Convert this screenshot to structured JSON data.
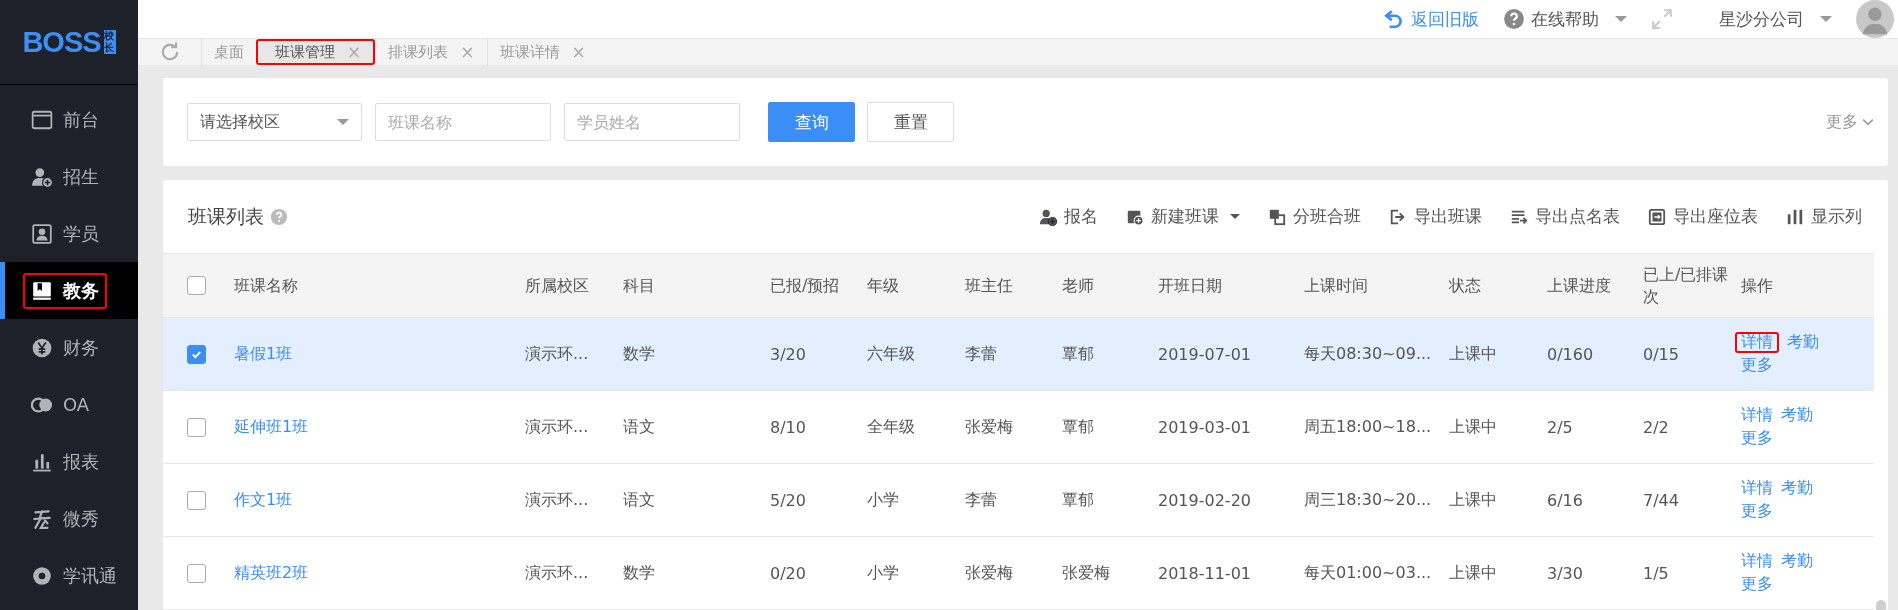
{
  "logo": {
    "text": "BOSS",
    "badge": "校长"
  },
  "sidebar": {
    "items": [
      {
        "label": "前台",
        "selected": false,
        "annotated": false
      },
      {
        "label": "招生",
        "selected": false,
        "annotated": false
      },
      {
        "label": "学员",
        "selected": false,
        "annotated": false
      },
      {
        "label": "教务",
        "selected": true,
        "annotated": true
      },
      {
        "label": "财务",
        "selected": false,
        "annotated": false
      },
      {
        "label": "OA",
        "selected": false,
        "annotated": false
      },
      {
        "label": "报表",
        "selected": false,
        "annotated": false
      },
      {
        "label": "微秀",
        "selected": false,
        "annotated": false
      },
      {
        "label": "学讯通",
        "selected": false,
        "annotated": false
      }
    ]
  },
  "header": {
    "back_link": "返回旧版",
    "help": "在线帮助",
    "company": "星沙分公司"
  },
  "tabs": [
    {
      "label": "桌面",
      "closable": false,
      "selected": false,
      "annotated": false
    },
    {
      "label": "班课管理",
      "closable": true,
      "selected": true,
      "annotated": true
    },
    {
      "label": "排课列表",
      "closable": true,
      "selected": false,
      "annotated": false
    },
    {
      "label": "班课详情",
      "closable": true,
      "selected": false,
      "annotated": false
    }
  ],
  "tab_close": "×",
  "filters": {
    "campus_select": {
      "placeholder": "请选择校区"
    },
    "class_name": {
      "placeholder": "班课名称"
    },
    "student_name": {
      "placeholder": "学员姓名"
    },
    "search_button": "查询",
    "reset_button": "重置",
    "more": "更多"
  },
  "table_card": {
    "title": "班课列表",
    "toolbar": [
      {
        "label": "报名",
        "dropdown": false
      },
      {
        "label": "新建班课",
        "dropdown": true
      },
      {
        "label": "分班合班",
        "dropdown": false
      },
      {
        "label": "导出班课",
        "dropdown": false
      },
      {
        "label": "导出点名表",
        "dropdown": false
      },
      {
        "label": "导出座位表",
        "dropdown": false
      },
      {
        "label": "显示列",
        "dropdown": false
      }
    ],
    "columns": [
      "班课名称",
      "所属校区",
      "科目",
      "已报/预招",
      "年级",
      "班主任",
      "老师",
      "开班日期",
      "上课时间",
      "状态",
      "上课进度",
      "已上/已排课次",
      "操作"
    ],
    "header_checked": false,
    "rows": [
      {
        "checked": true,
        "cells": [
          "暑假1班",
          "演示环...",
          "数学",
          "3/20",
          "六年级",
          "李蕾",
          "覃郁",
          "2019-07-01",
          "每天08:30~09...",
          "上课中",
          "0/160",
          "0/15"
        ],
        "actions": [
          {
            "label": "详情",
            "annotated": true
          },
          {
            "label": "考勤",
            "annotated": false
          },
          {
            "label": "更多",
            "annotated": false
          }
        ]
      },
      {
        "checked": false,
        "cells": [
          "延伸班1班",
          "演示环...",
          "语文",
          "8/10",
          "全年级",
          "张爱梅",
          "覃郁",
          "2019-03-01",
          "周五18:00~18...",
          "上课中",
          "2/5",
          "2/2"
        ],
        "actions": [
          {
            "label": "详情",
            "annotated": false
          },
          {
            "label": "考勤",
            "annotated": false
          },
          {
            "label": "更多",
            "annotated": false
          }
        ]
      },
      {
        "checked": false,
        "cells": [
          "作文1班",
          "演示环...",
          "语文",
          "5/20",
          "小学",
          "李蕾",
          "覃郁",
          "2019-02-20",
          "周三18:30~20...",
          "上课中",
          "6/16",
          "7/44"
        ],
        "actions": [
          {
            "label": "详情",
            "annotated": false
          },
          {
            "label": "考勤",
            "annotated": false
          },
          {
            "label": "更多",
            "annotated": false
          }
        ]
      },
      {
        "checked": false,
        "cells": [
          "精英班2班",
          "演示环...",
          "数学",
          "0/20",
          "小学",
          "张爱梅",
          "张爱梅",
          "2018-11-01",
          "每天01:00~03...",
          "上课中",
          "3/30",
          "1/5"
        ],
        "actions": [
          {
            "label": "详情",
            "annotated": false
          },
          {
            "label": "考勤",
            "annotated": false
          },
          {
            "label": "更多",
            "annotated": false
          }
        ]
      }
    ]
  }
}
